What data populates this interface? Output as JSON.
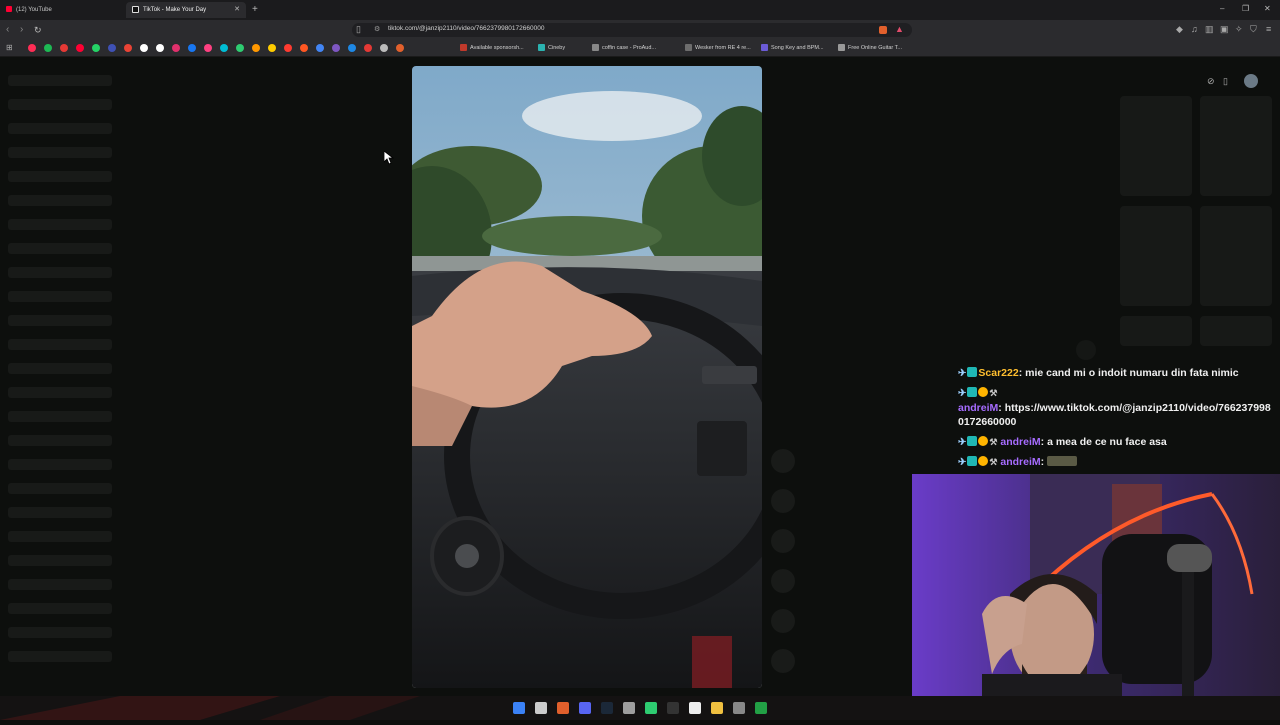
{
  "browser": {
    "tabs": [
      {
        "label": "(12) YouTube",
        "color": "#ff0033"
      },
      {
        "label": "TikTok - Make Your Day",
        "color": "#eeeeee"
      }
    ],
    "new_tab": "+",
    "window_controls": [
      "–",
      "❐",
      "✕"
    ],
    "url": "tiktok.com/@janzip2110/video/7662379980172660000",
    "bookmarks": [
      {
        "label": "Available sponsorsh...",
        "color": "#c0392b"
      },
      {
        "label": "Cineby",
        "color": "#2bb3b0"
      },
      {
        "label": "coffin case - ProAud...",
        "color": "#888888"
      },
      {
        "label": "Wesker from RE 4 re...",
        "color": "#6d6d6d"
      },
      {
        "label": "Song Key and BPM...",
        "color": "#6b5bd6"
      },
      {
        "label": "Free Online Guitar T...",
        "color": "#999999"
      }
    ],
    "bookmark_icon_colors": [
      "#ff2d55",
      "#1db954",
      "#e53935",
      "#ff0033",
      "#25d366",
      "#3f51b5",
      "#ea4335",
      "#ffffff",
      "#ffffff",
      "#e1306c",
      "#1877f2",
      "#ff4081",
      "#00bcd4",
      "#2ecc71",
      "#ff9800",
      "#ffcc00",
      "#ff3b30",
      "#ff5722",
      "#4285f4",
      "#7e57c2",
      "#1e88e5",
      "#e53935",
      "#bbbbbb",
      "#e2602c"
    ]
  },
  "chat": [
    {
      "badges": [
        "sword",
        "tv"
      ],
      "user": "Scar222",
      "user_type": "scar",
      "message": "mie cand mi o indoit numaru din fata nimic"
    },
    {
      "badges": [
        "sword",
        "tv",
        "one",
        "hammer"
      ],
      "user": "andreiM",
      "user_type": "andrei",
      "message": "https://www.tiktok.com/@janzip2110/video/766237998",
      "message_line2": "0172660000"
    },
    {
      "badges": [
        "sword",
        "tv",
        "one",
        "hammer"
      ],
      "user": "andreiM",
      "user_type": "andrei",
      "message": "a mea de ce nu face asa"
    },
    {
      "badges": [
        "sword",
        "tv",
        "one",
        "hammer"
      ],
      "user": "andreiM",
      "user_type": "andrei",
      "message": "",
      "emote": "emote"
    }
  ],
  "colors": {
    "page_bg": "#0d0f0d",
    "chat_text": "#f0f0f0",
    "user_scar": "#ffbf2f",
    "user_andrei": "#a66cff"
  },
  "taskbar_icons": [
    "windows-icon",
    "search-icon",
    "brave-icon",
    "discord-icon",
    "steam-icon",
    "calculator-icon",
    "xbox-icon",
    "spotify-icon",
    "capcut-icon",
    "files-icon",
    "settings-icon",
    "gamepass-icon"
  ]
}
